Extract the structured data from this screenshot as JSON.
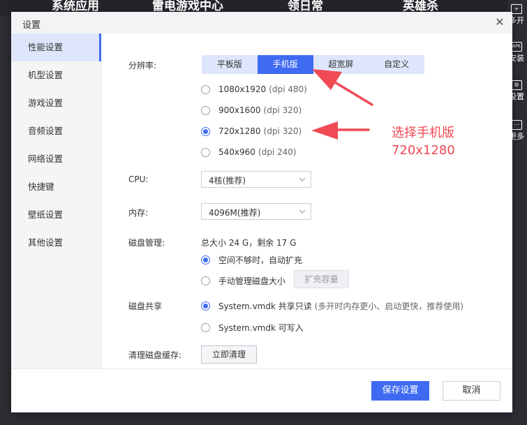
{
  "background": {
    "tabs": [
      "系统应用",
      "雷电游戏中心",
      "领日常",
      "英雄杀"
    ],
    "right_items": [
      {
        "icon": "+",
        "label": "多开"
      },
      {
        "icon": "APK",
        "label": "安装"
      },
      {
        "icon": "⚙",
        "label": "设置"
      },
      {
        "icon": "⋯",
        "label": "更多"
      }
    ]
  },
  "dialog": {
    "title": "设置",
    "close": "✕"
  },
  "sidebar": {
    "items": [
      {
        "label": "性能设置",
        "active": true
      },
      {
        "label": "机型设置"
      },
      {
        "label": "游戏设置"
      },
      {
        "label": "音频设置"
      },
      {
        "label": "网络设置"
      },
      {
        "label": "快捷键"
      },
      {
        "label": "壁纸设置"
      },
      {
        "label": "其他设置"
      }
    ]
  },
  "resolution": {
    "label": "分辨率:",
    "tabs": [
      "平板版",
      "手机版",
      "超宽屏",
      "自定义"
    ],
    "selected_tab": "手机版",
    "options": [
      {
        "res": "1080x1920",
        "dpi": "(dpi 480)"
      },
      {
        "res": "900x1600",
        "dpi": "(dpi 320)"
      },
      {
        "res": "720x1280",
        "dpi": "(dpi 320)",
        "checked": true
      },
      {
        "res": "540x960",
        "dpi": "(dpi 240)"
      }
    ]
  },
  "cpu": {
    "label": "CPU:",
    "value": "4核(推荐)"
  },
  "memory": {
    "label": "内存:",
    "value": "4096M(推荐)"
  },
  "disk": {
    "label": "磁盘管理:",
    "summary": "总大小 24 G，剩余 17 G",
    "option_auto": "空间不够时，自动扩充",
    "option_manual": "手动管理磁盘大小",
    "expand_button": "扩充容量"
  },
  "share": {
    "label": "磁盘共享",
    "option_readonly": "System.vmdk 共享只读",
    "option_readonly_note": "(多开时内存更小、启动更快，推荐使用)",
    "option_writable": "System.vmdk 可写入"
  },
  "cache": {
    "label": "清理磁盘缓存:",
    "button": "立即清理"
  },
  "footer": {
    "save": "保存设置",
    "cancel": "取消"
  },
  "annotation": {
    "line1": "选择手机版",
    "line2": "720x1280",
    "color": "#f04a55"
  },
  "colors": {
    "accent": "#3f6bf2",
    "segment_bg": "#dfe6fb"
  }
}
